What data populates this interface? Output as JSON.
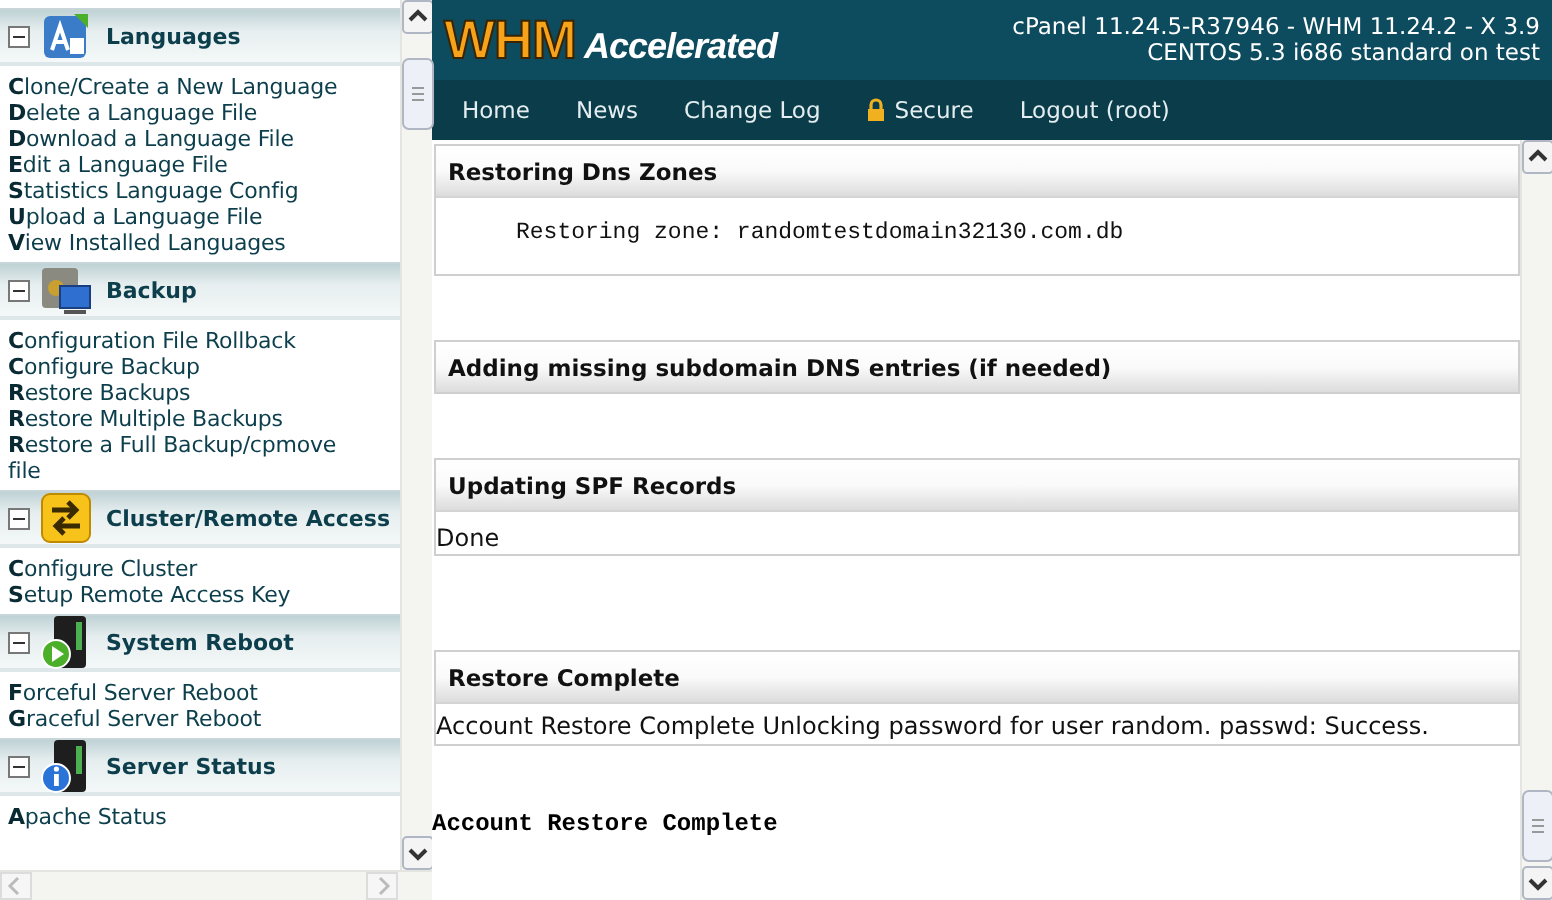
{
  "sidebar": {
    "groups": [
      {
        "title": "Languages",
        "kind": "languages",
        "expanded": true,
        "links": [
          "**C**lone/Create a New Language",
          "**D**elete a Language File",
          "**D**ownload a Language File",
          "**E**dit a Language File",
          "**S**tatistics Language Config",
          "**U**pload a Language File",
          "**V**iew Installed Languages"
        ]
      },
      {
        "title": "Backup",
        "kind": "backup",
        "expanded": true,
        "links": [
          "**C**onfiguration File Rollback",
          "**C**onfigure Backup",
          "**R**estore Backups",
          "**R**estore Multiple Backups",
          "**R**estore a Full Backup/cpmove file"
        ]
      },
      {
        "title": "Cluster/Remote Access",
        "kind": "cluster",
        "expanded": true,
        "links": [
          "**C**onfigure Cluster",
          "**S**etup Remote Access Key"
        ]
      },
      {
        "title": "System Reboot",
        "kind": "reboot",
        "expanded": true,
        "links": [
          "**F**orceful Server Reboot",
          "**G**raceful Server Reboot"
        ]
      },
      {
        "title": "Server Status",
        "kind": "status",
        "expanded": true,
        "links": [
          "**A**pache Status"
        ]
      }
    ]
  },
  "header": {
    "logo_main": "WHM",
    "logo_sub": "Accelerated",
    "version": "cPanel 11.24.5-R37946 - WHM 11.24.2 - X 3.9",
    "system": "CENTOS 5.3 i686 standard on test"
  },
  "nav": [
    {
      "label": "Home",
      "secure": false
    },
    {
      "label": "News",
      "secure": false
    },
    {
      "label": "Change Log",
      "secure": false
    },
    {
      "label": "Secure",
      "secure": true
    },
    {
      "label": "Logout (root)",
      "secure": false
    }
  ],
  "sections": [
    {
      "title": "Restoring Dns Zones",
      "kind": "mono",
      "body": "Restoring zone: randomtestdomain32130.com.db"
    },
    {
      "title": "Adding missing subdomain DNS entries (if needed)",
      "kind": "empty"
    },
    {
      "title": "Updating SPF Records",
      "kind": "text",
      "body": "Done"
    },
    {
      "title": "Restore Complete",
      "kind": "text",
      "body": "Account Restore Complete Unlocking password for user random. passwd: Success."
    }
  ],
  "final_message": "Account Restore Complete"
}
